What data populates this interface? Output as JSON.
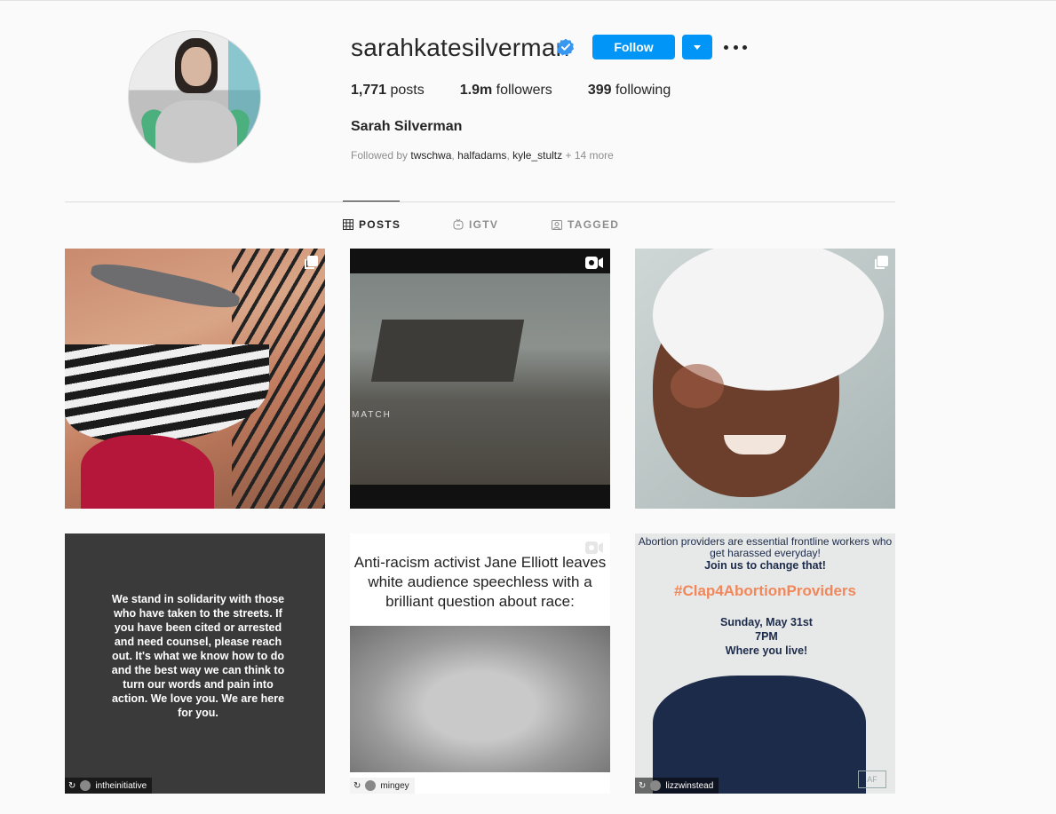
{
  "profile": {
    "username": "sarahkatesilverman",
    "follow_label": "Follow",
    "posts_count": "1,771",
    "posts_label": "posts",
    "followers_count": "1.9m",
    "followers_label": "followers",
    "following_count": "399",
    "following_label": "following",
    "full_name": "Sarah Silverman",
    "followed_by_prefix": "Followed by ",
    "followed_by_users": [
      "twschwa",
      "halfadams",
      "kyle_stultz"
    ],
    "followed_by_more": " + 14 more"
  },
  "tabs": [
    {
      "label": "POSTS",
      "icon": "grid-icon"
    },
    {
      "label": "IGTV",
      "icon": "igtv-icon"
    },
    {
      "label": "TAGGED",
      "icon": "tagged-icon"
    }
  ],
  "posts": [
    {
      "watermark": ""
    },
    {
      "watermark": "MATCH"
    },
    {
      "watermark": ""
    },
    {
      "text": "We stand in solidarity with those who have taken to the streets. If you have been cited or arrested and need counsel, please reach out. It's what we know how to do and the best way we can think to turn our words and pain into action. We love you. We are here for you.",
      "repost_user": "intheinitiative"
    },
    {
      "text": "Anti-racism activist Jane Elliott leaves white audience speechless with a brilliant question about race:",
      "repost_user": "mingey"
    },
    {
      "line1": "Abortion providers are essential frontline workers who get harassed everyday!",
      "line2": "Join us to change that!",
      "hashtag": "#Clap4AbortionProviders",
      "date": "Sunday, May 31st",
      "time": "7PM",
      "location": "Where you live!",
      "logo": "AF",
      "repost_user": "lizzwinstead"
    }
  ],
  "colors": {
    "accent": "#0095f6",
    "verified": "#3897f0"
  }
}
